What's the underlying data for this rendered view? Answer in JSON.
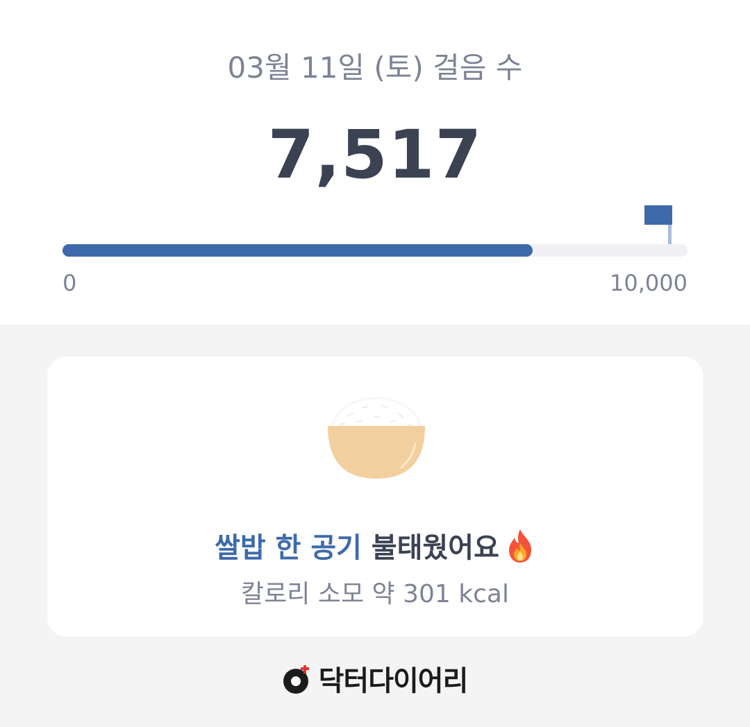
{
  "header": {
    "date_title": "03월 11일 (토) 걸음 수",
    "step_count": "7,517"
  },
  "progress": {
    "value": 7517,
    "goal": 10000,
    "fraction": 0.7517,
    "min_label": "0",
    "max_label": "10,000"
  },
  "card": {
    "icon": "rice-bowl-icon",
    "message_highlight": "쌀밥 한 공기",
    "message_rest": " 불태웠어요",
    "message_icon": "fire-icon",
    "calorie_text": "칼로리 소모 약 301 kcal"
  },
  "brand": {
    "name": "닥터다이어리",
    "logo_icon": "doctor-diary-logo-icon"
  },
  "colors": {
    "accent": "#3e6aab",
    "text_dark": "#3b4252",
    "text_muted": "#7d8394",
    "track": "#f1f1f3",
    "rice_bowl": "#f2cf9e",
    "page_background": "#f4f4f4"
  }
}
